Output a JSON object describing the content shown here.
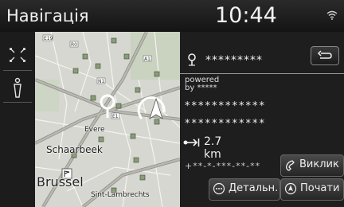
{
  "statusbar": {
    "title": "Навігація",
    "time": "10:44"
  },
  "map": {
    "labels": {
      "schaarbeek": "Schaarbeek",
      "brussels": "Brussel",
      "evere": "Evere",
      "stlambrechts": "Sint-Lambrechts"
    }
  },
  "destination": {
    "name": "*********",
    "powered_line1": "powered",
    "powered_line2": "by *****",
    "address_line1": "************",
    "address_line2": "************",
    "distance": "2.7 km",
    "phone": "+**-*-***-**-**"
  },
  "buttons": {
    "call": "Виклик",
    "details": "Детальн.",
    "start": "Почати"
  }
}
